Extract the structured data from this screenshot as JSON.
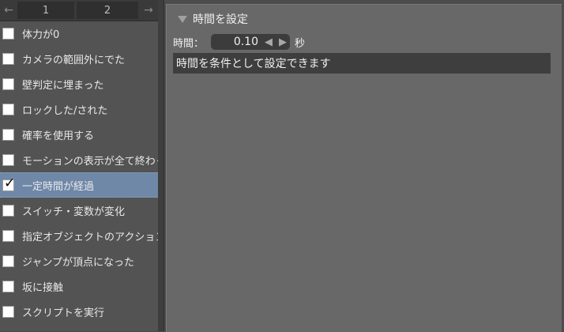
{
  "pager": {
    "prev_icon": "←",
    "next_icon": "→",
    "pages": [
      "1",
      "2"
    ]
  },
  "conditions": [
    {
      "label": "体力が0",
      "checked": false
    },
    {
      "label": "カメラの範囲外にでた",
      "checked": false
    },
    {
      "label": "壁判定に埋まった",
      "checked": false
    },
    {
      "label": "ロックした/された",
      "checked": false
    },
    {
      "label": "確率を使用する",
      "checked": false
    },
    {
      "label": "モーションの表示が全て終わった",
      "checked": false
    },
    {
      "label": "一定時間が経過",
      "checked": true
    },
    {
      "label": "スイッチ・変数が変化",
      "checked": false
    },
    {
      "label": "指定オブジェクトのアクションが",
      "checked": false
    },
    {
      "label": "ジャンプが頂点になった",
      "checked": false
    },
    {
      "label": "坂に接触",
      "checked": false
    },
    {
      "label": "スクリプトを実行",
      "checked": false
    }
  ],
  "check_mark": "✓",
  "section": {
    "title": "時間を設定",
    "time_label": "時間：",
    "time_value": "0.10",
    "decrement_icon": "◀",
    "increment_icon": "▶",
    "unit": "秒",
    "description": "時間を条件として設定できます"
  },
  "colors": {
    "selected_row": "#6f88a8",
    "panel_bg": "#535353",
    "content_bg": "#686868",
    "field_bg": "#3e3e3e"
  }
}
